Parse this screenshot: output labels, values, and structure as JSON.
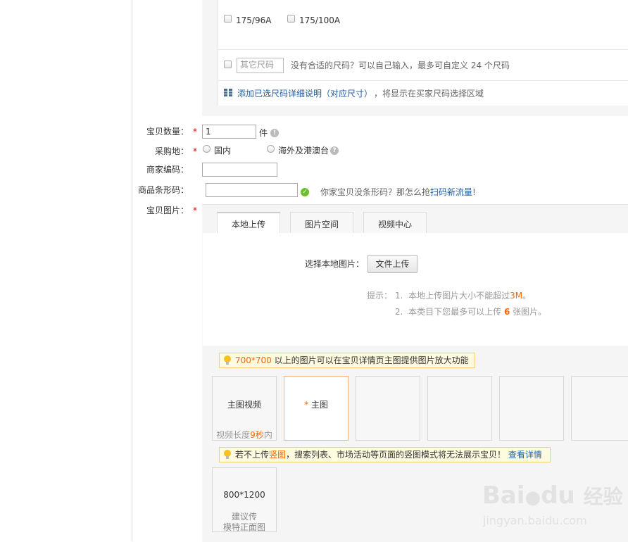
{
  "sizes": {
    "option1": "175/96A",
    "option2": "175/100A",
    "other_placeholder": "其它尺码",
    "other_hint": "没有合适的尺码？可以自己输入，最多可自定义 24 个尺码",
    "detail_link": "添加已选尺码详细说明（对应尺寸）",
    "detail_suffix": "，将显示在买家尺码选择区域"
  },
  "required_mark": "*",
  "quantity": {
    "label": "宝贝数量：",
    "value": "1",
    "unit": "件",
    "help_glyph": "!"
  },
  "purchase_place": {
    "label": "采购地：",
    "opt_domestic": "国内",
    "opt_overseas": "海外及港澳台",
    "help_glyph": "?"
  },
  "merchant_code": {
    "label": "商家编码：",
    "value": ""
  },
  "barcode": {
    "label": "商品条形码：",
    "value": "",
    "ok_glyph": "✓",
    "hint_prefix": "你家宝贝没条形码？那怎么抢",
    "hint_link": "扫码新流量",
    "hint_suffix": "!"
  },
  "images": {
    "label": "宝贝图片：",
    "tabs": [
      "本地上传",
      "图片空间",
      "视频中心"
    ],
    "select_label": "选择本地图片：",
    "upload_button": "文件上传",
    "tip_label": "提示：",
    "tip1_num": "1.",
    "tip1_text": "本地上传图片大小不能超过",
    "tip1_value": "3M",
    "tip1_end": "。",
    "tip2_num": "2.",
    "tip2_text": "本类目下您最多可以上传",
    "tip2_value": "6",
    "tip2_end": "张图片。",
    "zoom_tip_value": "700*700",
    "zoom_tip_text": "以上的图片可以在宝贝详情页主图提供图片放大功能",
    "slot_video": "主图视频",
    "slot_video_len_a": "视频长度",
    "slot_video_len_b": "9秒",
    "slot_video_len_c": "内",
    "slot_main_mark": "*",
    "slot_main": "主图",
    "vertical_tip_a": "若不上传",
    "vertical_tip_link": "竖图",
    "vertical_tip_b": "，搜索列表、市场活动等页面的竖图模式将无法展示宝贝！",
    "vertical_tip_detail": "查看详情",
    "vertical_size": "800*1200",
    "vertical_hint_line1": "建议传",
    "vertical_hint_line2": "模特正面图"
  },
  "watermark": {
    "brand_a": "Bai",
    "brand_b": "du",
    "brand_cn": "经验",
    "url": "jingyan.baidu.com"
  },
  "colors": {
    "accent_orange": "#ff6600",
    "link_blue": "#1f5fa6",
    "required_red": "#dd0000",
    "tip_border": "#f0d070"
  }
}
